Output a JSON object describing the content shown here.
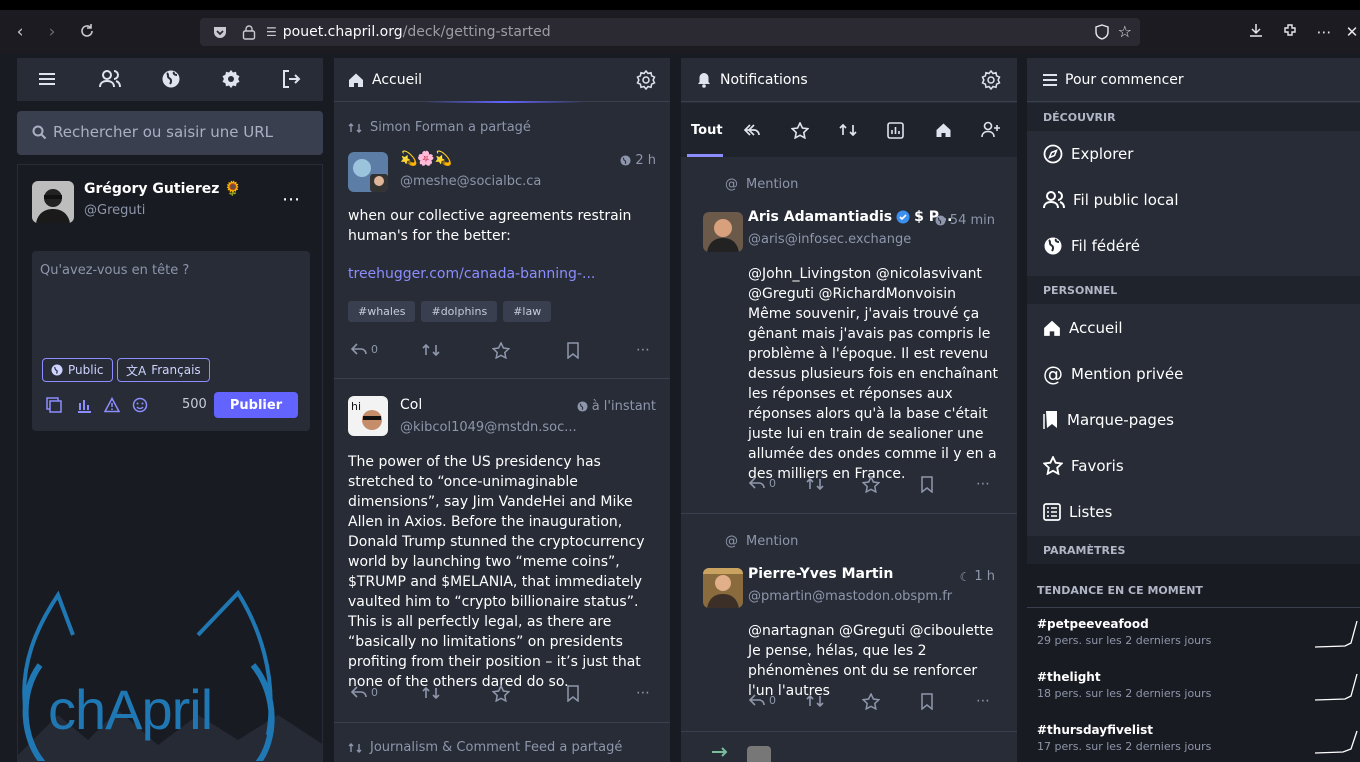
{
  "browser": {
    "url_scheme_icon": "link-icon",
    "url_host": "pouet.chapril.org",
    "url_path": "/deck/getting-started",
    "url_prefix": ""
  },
  "compose": {
    "user_name": "Grégory Gutierez",
    "user_emoji": "🌻",
    "user_handle": "@Greguti",
    "placeholder": "Qu'avez-vous en tête ?",
    "visibility": "Public",
    "language": "Français",
    "char_count": "500",
    "publish": "Publier",
    "search_placeholder": "Rechercher ou saisir une URL"
  },
  "home": {
    "title": "Accueil",
    "statuses": [
      {
        "boost_label": "Simon Forman a partagé",
        "name": "💫🌸💫",
        "handle": "@meshe@socialbc.ca",
        "time": "2 h",
        "text": "when our collective agreements restrain human's for the better:",
        "link": "treehugger.com/canada-banning-...",
        "tags": [
          "#whales",
          "#dolphins",
          "#law"
        ],
        "replies": "0"
      },
      {
        "name": "Col",
        "handle": "@kibcol1049@mstdn.soc...",
        "time": "à l'instant",
        "text": "The power of the US presidency has stretched to “once-unimaginable dimensions”, say Jim VandeHei and Mike Allen in Axios. Before the inauguration, Donald Trump stunned the cryptocurrency world by launching two “meme coins”, $TRUMP and $MELANIA, that immediately vaulted him to “crypto billionaire status”. This is all perfectly legal, as there are “basically no limitations” on presidents profiting from their position – it’s just that none of the others dared do so.",
        "replies": "0"
      },
      {
        "boost_label": "Journalism & Comment Feed a partagé"
      }
    ]
  },
  "notifications": {
    "title": "Notifications",
    "tab_all": "Tout",
    "items": [
      {
        "type_label": "Mention",
        "name": "Aris Adamantiadis",
        "name_extra": "$ P...",
        "handle": "@aris@infosec.exchange",
        "time": "54 min",
        "mentions": "@John_Livingston @nicolasvivant @Greguti @RichardMonvoisin",
        "text": "Même souvenir, j'avais trouvé ça gênant mais j'avais pas compris le problème à l'époque. Il est revenu dessus plusieurs fois en enchaînant les réponses et réponses aux réponses alors qu'à la base c'était juste lui en train de sealioner une allumée des ondes comme il y en a des milliers en France.",
        "replies": "0"
      },
      {
        "type_label": "Mention",
        "name": "Pierre-Yves Martin",
        "handle": "@pmartin@mastodon.obspm.fr",
        "time": "1 h",
        "mentions": "@nartagnan @Greguti @ciboulette",
        "text": "Je pense, hélas, que les 2 phénomènes ont du se renforcer l'un l'autres",
        "replies": "0"
      }
    ]
  },
  "getting_started": {
    "title": "Pour commencer",
    "section_discover": "DÉCOUVRIR",
    "explore": "Explorer",
    "local": "Fil public local",
    "federated": "Fil fédéré",
    "section_personal": "PERSONNEL",
    "home": "Accueil",
    "direct": "Mention privée",
    "bookmarks": "Marque-pages",
    "favourites": "Favoris",
    "lists": "Listes",
    "section_settings": "PARAMÈTRES",
    "trending_title": "TENDANCE EN CE MOMENT",
    "trends": [
      {
        "tag": "#petpeeveafood",
        "uses": "29 pers. sur les 2 derniers jours"
      },
      {
        "tag": "#thelight",
        "uses": "18 pers. sur les 2 derniers jours"
      },
      {
        "tag": "#thursdayfivelist",
        "uses": "17 pers. sur les 2 derniers jours"
      }
    ]
  },
  "mascot_text": "chApril",
  "colors": {
    "accent": "#6364ff",
    "bg": "#282c37",
    "bg_dark": "#191b22",
    "muted": "#8e96ab",
    "link": "#8c8dff"
  }
}
